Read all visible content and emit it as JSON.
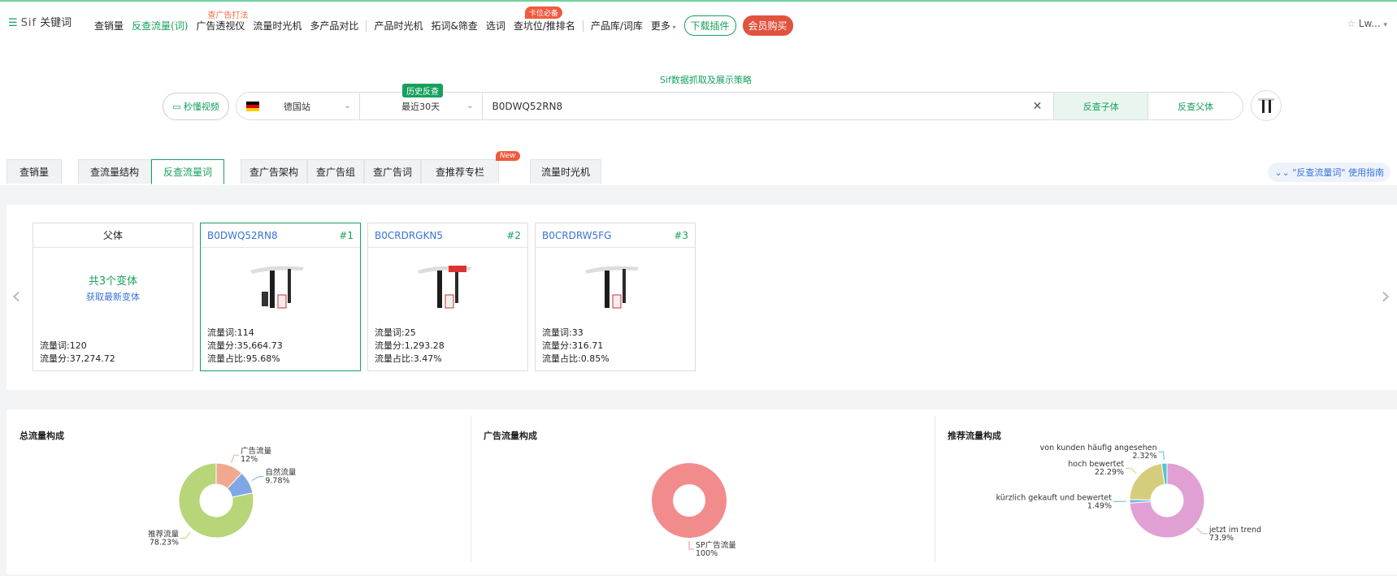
{
  "topbar": {
    "logo_text": "Sif",
    "logo_sub": "关键词",
    "nav": [
      {
        "label": "查销量",
        "active": false
      },
      {
        "label": "反查流量(词)",
        "active": true
      },
      {
        "label": "广告透视仪",
        "badge": "查广告打法"
      },
      {
        "label": "流量时光机"
      },
      {
        "label": "多产品对比"
      },
      {
        "label": "产品时光机"
      },
      {
        "label": "拓词&筛查"
      },
      {
        "label": "选词"
      },
      {
        "label": "查坑位/推排名",
        "badge": "卡位必备"
      },
      {
        "label": "产品库/词库"
      },
      {
        "label": "更多"
      }
    ],
    "download": "下载插件",
    "vip": "会员购买",
    "user": "Lw..."
  },
  "search": {
    "hint": "Sif数据抓取及展示策略",
    "video_btn": "秒懂视频",
    "site": "德国站",
    "range_badge": "历史反查",
    "range": "最近30天",
    "asin": "B0DWQ52RN8",
    "btn_child": "反查子体",
    "btn_parent": "反查父体"
  },
  "tabs": {
    "items": [
      "查销量",
      "查流量结构",
      "反查流量词",
      "查广告架构",
      "查广告组",
      "查广告词",
      "查推荐专栏",
      "流量时光机"
    ],
    "new_badge": "New",
    "guide": "\"反查流量词\" 使用指南"
  },
  "variants": {
    "parent": {
      "title": "父体",
      "total": "共3个变体",
      "fetch": "获取最新变体",
      "words": "流量词:120",
      "score": "流量分:37,274.72"
    },
    "cards": [
      {
        "asin": "B0DWQ52RN8",
        "rank": "#1",
        "words": "流量词:114",
        "score": "流量分:35,664.73",
        "share": "流量占比:95.68%"
      },
      {
        "asin": "B0CRDRGKN5",
        "rank": "#2",
        "words": "流量词:25",
        "score": "流量分:1,293.28",
        "share": "流量占比:3.47%"
      },
      {
        "asin": "B0CRDRW5FG",
        "rank": "#3",
        "words": "流量词:33",
        "score": "流量分:316.71",
        "share": "流量占比:0.85%"
      }
    ]
  },
  "charts_titles": [
    "总流量构成",
    "广告流量构成",
    "推荐流量构成"
  ],
  "chart_data": [
    {
      "type": "pie",
      "title": "总流量构成",
      "slices": [
        {
          "label": "广告流量",
          "value": 12,
          "display": "12%",
          "color": "#f0a98e"
        },
        {
          "label": "自然流量",
          "value": 9.78,
          "display": "9.78%",
          "color": "#7fa7e6"
        },
        {
          "label": "推荐流量",
          "value": 78.23,
          "display": "78.23%",
          "color": "#b8d57a"
        }
      ]
    },
    {
      "type": "pie",
      "title": "广告流量构成",
      "slices": [
        {
          "label": "SP广告流量",
          "value": 100,
          "display": "100%",
          "color": "#f28c8c"
        }
      ]
    },
    {
      "type": "pie",
      "title": "推荐流量构成",
      "slices": [
        {
          "label": "jetzt im trend",
          "value": 73.9,
          "display": "73.9%",
          "color": "#e0a0d4"
        },
        {
          "label": "kürzlich gekauft und bewertet",
          "value": 1.49,
          "display": "1.49%",
          "color": "#6fb4e8"
        },
        {
          "label": "hoch bewertet",
          "value": 22.29,
          "display": "22.29%",
          "color": "#d4ce7c"
        },
        {
          "label": "von kunden häufig angesehen",
          "value": 2.32,
          "display": "2.32%",
          "color": "#4fc7cf"
        }
      ]
    }
  ]
}
